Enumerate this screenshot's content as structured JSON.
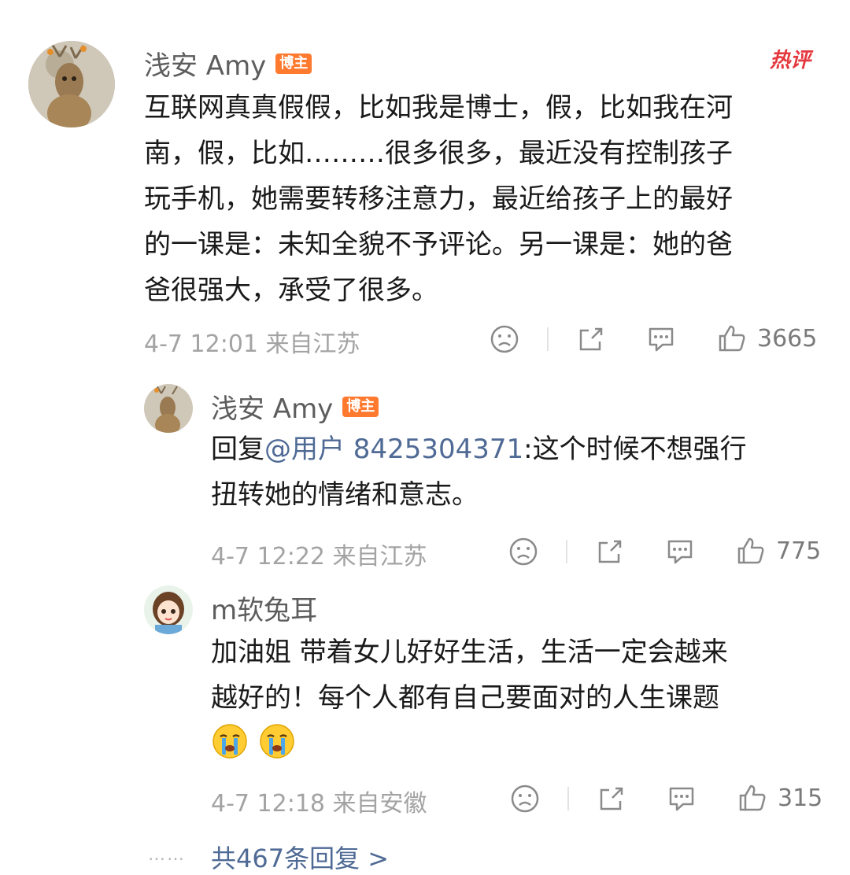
{
  "hot_label": "热评",
  "main_comment": {
    "user": "浅安 Amy",
    "badge": "博主",
    "lines": [
      "互联网真真假假，比如我是博士，假，比如我在河",
      "南，假，比如………很多很多，最近没有控制孩子",
      "玩手机，她需要转移注意力，最近给孩子上的最好",
      "的一课是：未知全貌不予评论。另一课是：她的爸",
      "爸很强大，承受了很多。"
    ],
    "meta": "4-7 12:01 来自江苏",
    "likes": "3665"
  },
  "reply1": {
    "user": "浅安 Amy",
    "badge": "博主",
    "prefix": "回复",
    "mention": "@用户 8425304371",
    "line1_rest": ":这个时候不想强行",
    "line2": "扭转她的情绪和意志。",
    "meta": "4-7 12:22 来自江苏",
    "likes": "775"
  },
  "reply2": {
    "user": "m软兔耳",
    "lines": [
      "加油姐 带着女儿好好生活，生活一定会越来",
      "越好的！每个人都有自己要面对的人生课题"
    ],
    "emojis": [
      "crying-face-emoji",
      "crying-face-emoji"
    ],
    "meta": "4-7 12:18 来自安徽",
    "likes": "315"
  },
  "more": {
    "dots": "……",
    "label": "共467条回复 >"
  }
}
